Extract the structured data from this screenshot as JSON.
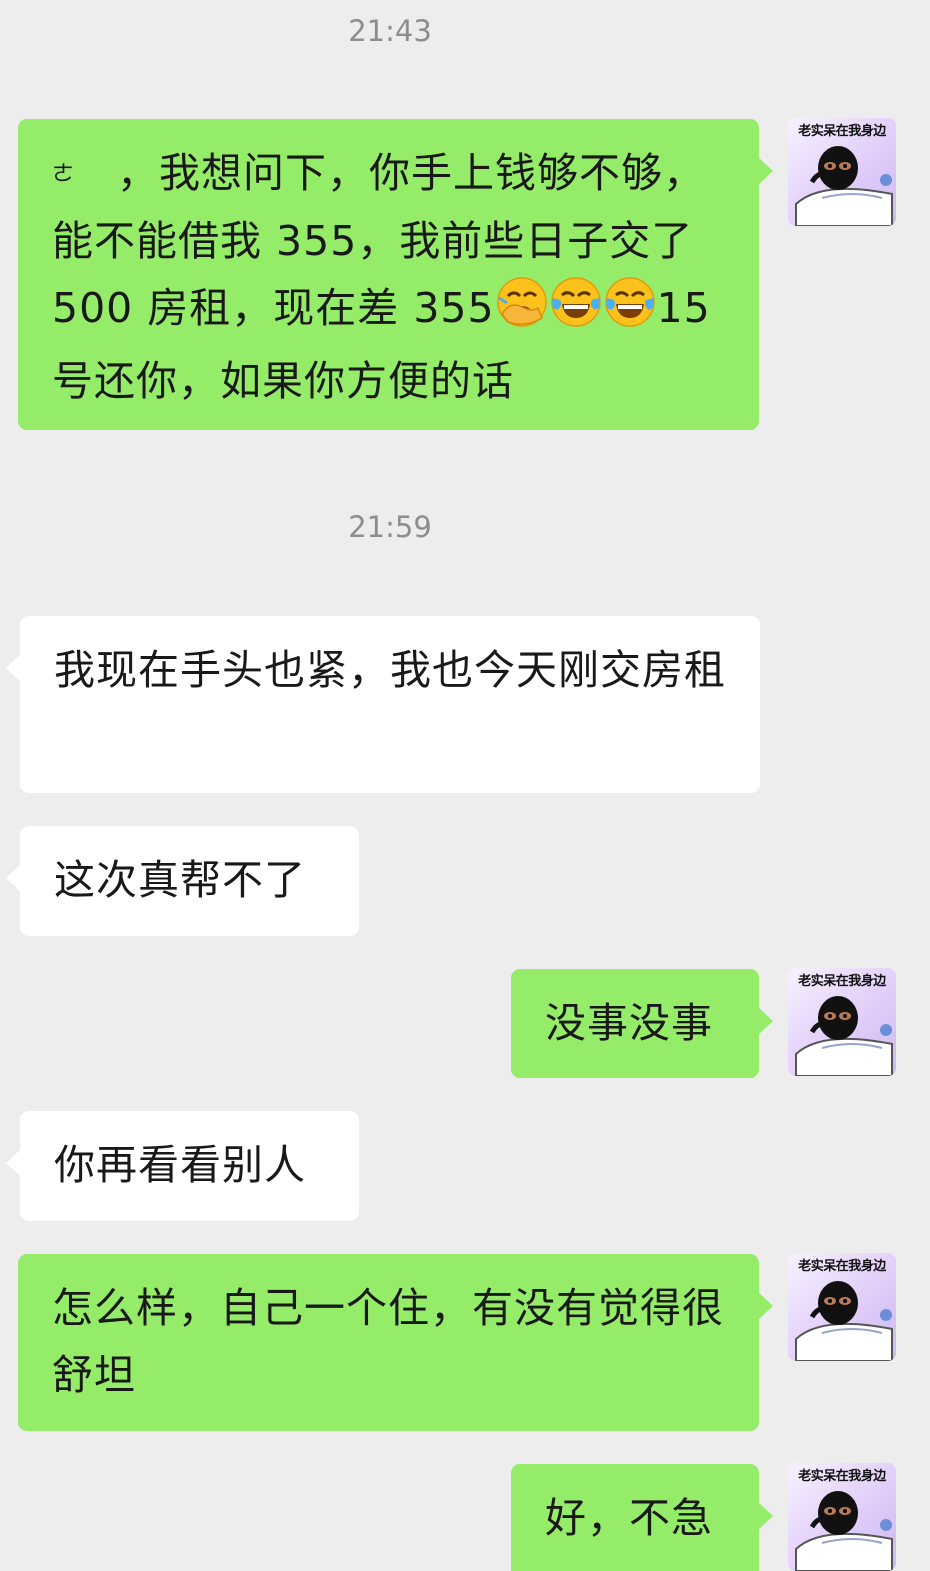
{
  "timestamps": [
    "21:43",
    "21:59"
  ],
  "avatar": {
    "caption": "老实呆在我身边",
    "icon": "masked-person-sticker-avatar"
  },
  "colors": {
    "background": "#ededed",
    "my_bubble": "#95ec69",
    "their_bubble": "#ffffff",
    "timestamp": "#8d8d8d"
  },
  "messages": [
    {
      "side": "right",
      "parts": [
        {
          "t": "text",
          "v": "ㄜ"
        },
        {
          "t": "text",
          "v": "　，我想问下，你手上钱够不够，能不能借我 355，我前些日子交了 500 房租，现在差 355"
        },
        {
          "t": "emoji",
          "v": "face-with-hand-over-mouth-emoji"
        },
        {
          "t": "emoji",
          "v": "tears-of-joy-emoji"
        },
        {
          "t": "emoji",
          "v": "tears-of-joy-emoji"
        },
        {
          "t": "text",
          "v": "15 号还你，如果你方便的话"
        }
      ]
    },
    {
      "side": "left",
      "text": "我现在手头也紧，我也今天刚交房租"
    },
    {
      "side": "left",
      "text": "这次真帮不了"
    },
    {
      "side": "right",
      "text": "没事没事"
    },
    {
      "side": "left",
      "text": "你再看看别人"
    },
    {
      "side": "right",
      "text": "怎么样，自己一个住，有没有觉得很舒坦"
    },
    {
      "side": "right",
      "text": "好，不急"
    }
  ]
}
